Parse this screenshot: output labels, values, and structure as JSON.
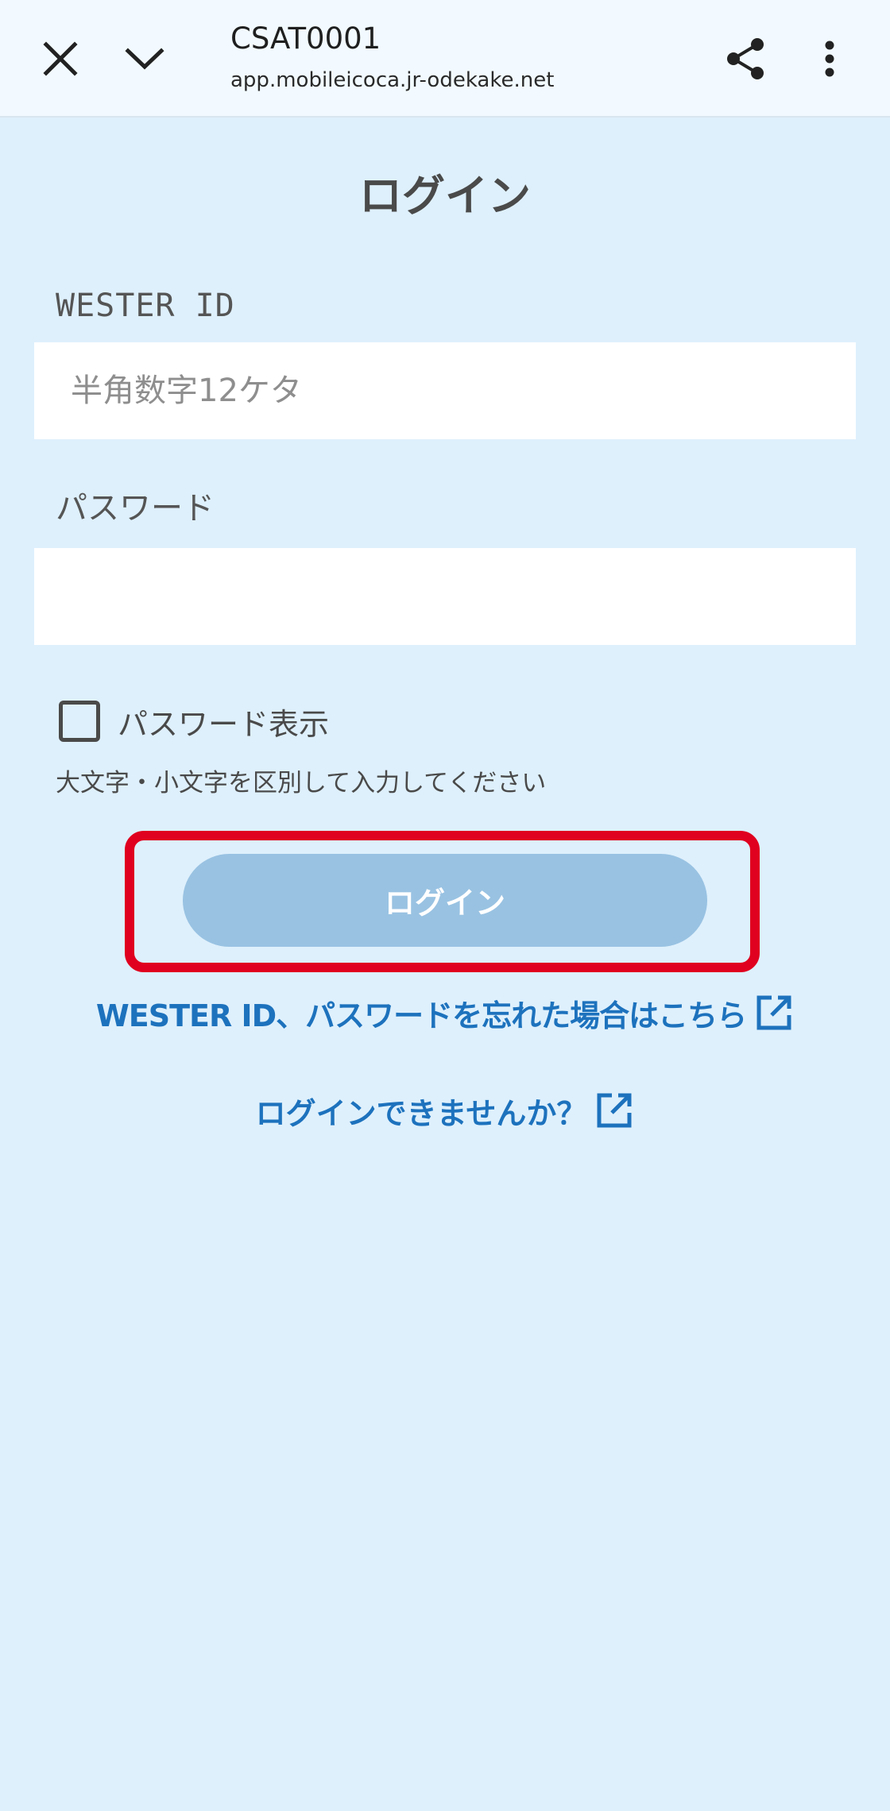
{
  "browser": {
    "tab_title": "CSAT0001",
    "url": "app.mobileicoca.jr-odekake.net"
  },
  "page": {
    "heading": "ログイン",
    "wester_id_label": "WESTER ID",
    "wester_id_placeholder": "半角数字12ケタ",
    "password_label": "パスワード",
    "password_placeholder": "",
    "show_password_label": "パスワード表示",
    "case_hint": "大文字・小文字を区別して入力してください",
    "login_button_label": "ログイン",
    "forgot_link": "WESTER ID、パスワードを忘れた場合はこちら",
    "cant_login_link": "ログインできませんか？"
  },
  "icons": {
    "close": "close-icon",
    "collapse": "chevron-down-icon",
    "share": "share-icon",
    "more": "more-vert-icon",
    "external": "external-link-icon"
  },
  "colors": {
    "background": "#def0fc",
    "link": "#1d72bd",
    "login_button": "#99c2e2",
    "highlight": "#e0001f"
  }
}
